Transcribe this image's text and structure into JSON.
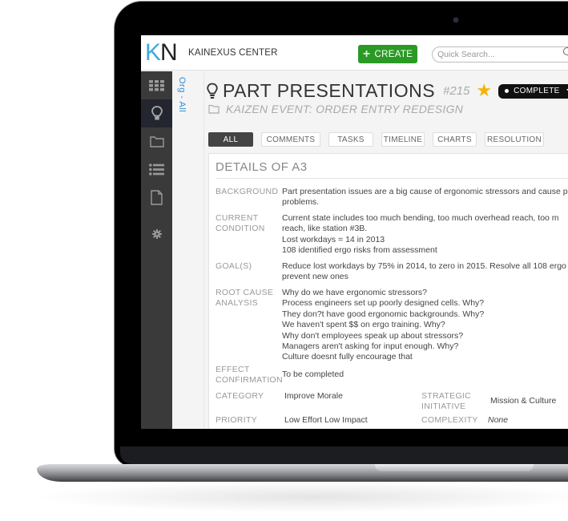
{
  "app": {
    "logo_k": "K",
    "logo_n": "N",
    "title": "KAINEXUS CENTER",
    "create_label": "CREATE",
    "search_placeholder": "Quick Search..."
  },
  "sidebar": {
    "items": [
      {
        "icon": "grid-icon"
      },
      {
        "icon": "lightbulb-icon",
        "active": true
      },
      {
        "icon": "folder-icon"
      },
      {
        "icon": "list-icon"
      },
      {
        "icon": "document-icon"
      },
      {
        "icon": "gear-icon"
      }
    ]
  },
  "org_label": "Org - All",
  "item": {
    "title": "PART PRESENTATIONS",
    "number": "#215",
    "starred": true,
    "status": "COMPLETE",
    "project": "KAIZEN EVENT: ORDER ENTRY REDESIGN"
  },
  "tabs": [
    "ALL",
    "COMMENTS",
    "TASKS",
    "TIMELINE",
    "CHARTS",
    "RESOLUTION"
  ],
  "active_tab": "ALL",
  "details": {
    "title": "DETAILS OF A3",
    "background": {
      "label": "BACKGROUND",
      "lines": [
        "Part presentation issues are a big cause of ergonomic stressors and cause p",
        "problems."
      ]
    },
    "current_condition": {
      "label_lines": [
        "CURRENT",
        "CONDITION"
      ],
      "lines": [
        "Current state includes too much bending, too much overhead reach, too m",
        "reach, like station #3B.",
        "Lost workdays = 14 in 2013",
        "108 identified ergo risks from assessment"
      ]
    },
    "goals": {
      "label": "GOAL(S)",
      "lines": [
        "Reduce lost workdays by 75% in 2014, to zero in 2015. Resolve all 108 ergo",
        "prevent new ones"
      ]
    },
    "root_cause": {
      "label_lines": [
        "ROOT CAUSE",
        "ANALYSIS"
      ],
      "lines": [
        "Why do we have ergonomic stressors?",
        "Process engineers set up poorly designed cells. Why?",
        "They don?t have good ergonomic backgrounds. Why?",
        "We haven't spent $$ on ergo training. Why?",
        "Why don't employees speak up about stressors?",
        "Managers aren't asking for input enough. Why?",
        "Culture doesnt fully encourage that"
      ]
    },
    "effect_confirmation": {
      "label_lines": [
        "EFFECT",
        "CONFIRMATION"
      ],
      "value": "To be completed"
    },
    "category": {
      "label": "CATEGORY",
      "value": "Improve Morale"
    },
    "strategic_initiative": {
      "label_lines": [
        "STRATEGIC",
        "INITIATIVE"
      ],
      "value": "Mission & Culture"
    },
    "priority": {
      "label": "PRIORITY",
      "value": "Low Effort Low Impact"
    },
    "complexity": {
      "label": "COMPLEXITY",
      "value": "None"
    }
  },
  "colors": {
    "accent_blue": "#3fa9de",
    "create_green": "#2a9a25",
    "star": "#f4b400",
    "sidebar": "#3a3a3a"
  }
}
